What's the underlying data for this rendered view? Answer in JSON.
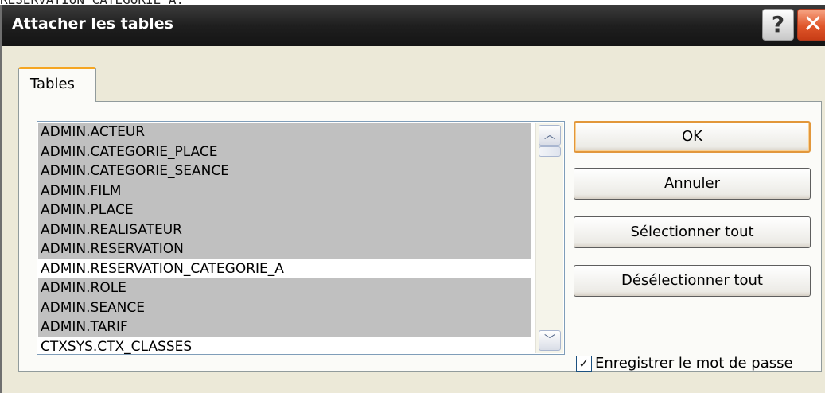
{
  "background_text": "RESERVATION_CATEGORIE_A.",
  "dialog": {
    "title": "Attacher les tables",
    "help_label": "?",
    "close_label": "✕"
  },
  "tab": {
    "label": "Tables"
  },
  "tables": [
    {
      "name": "ADMIN.ACTEUR",
      "selected": true
    },
    {
      "name": "ADMIN.CATEGORIE_PLACE",
      "selected": true
    },
    {
      "name": "ADMIN.CATEGORIE_SEANCE",
      "selected": true
    },
    {
      "name": "ADMIN.FILM",
      "selected": true
    },
    {
      "name": "ADMIN.PLACE",
      "selected": true
    },
    {
      "name": "ADMIN.REALISATEUR",
      "selected": true
    },
    {
      "name": "ADMIN.RESERVATION",
      "selected": true
    },
    {
      "name": "ADMIN.RESERVATION_CATEGORIE_A",
      "selected": false
    },
    {
      "name": "ADMIN.ROLE",
      "selected": true
    },
    {
      "name": "ADMIN.SEANCE",
      "selected": true
    },
    {
      "name": "ADMIN.TARIF",
      "selected": true
    },
    {
      "name": "CTXSYS.CTX_CLASSES",
      "selected": false
    }
  ],
  "buttons": {
    "ok": "OK",
    "cancel": "Annuler",
    "select_all": "Sélectionner tout",
    "deselect_all": "Désélectionner tout"
  },
  "save_password": {
    "label": "Enregistrer le mot de passe",
    "checked": true
  },
  "colors": {
    "selection": "#c0c0c0",
    "default_button_border": "#e2973b",
    "tab_accent": "#f5a623",
    "close_button": "#e0562a"
  }
}
